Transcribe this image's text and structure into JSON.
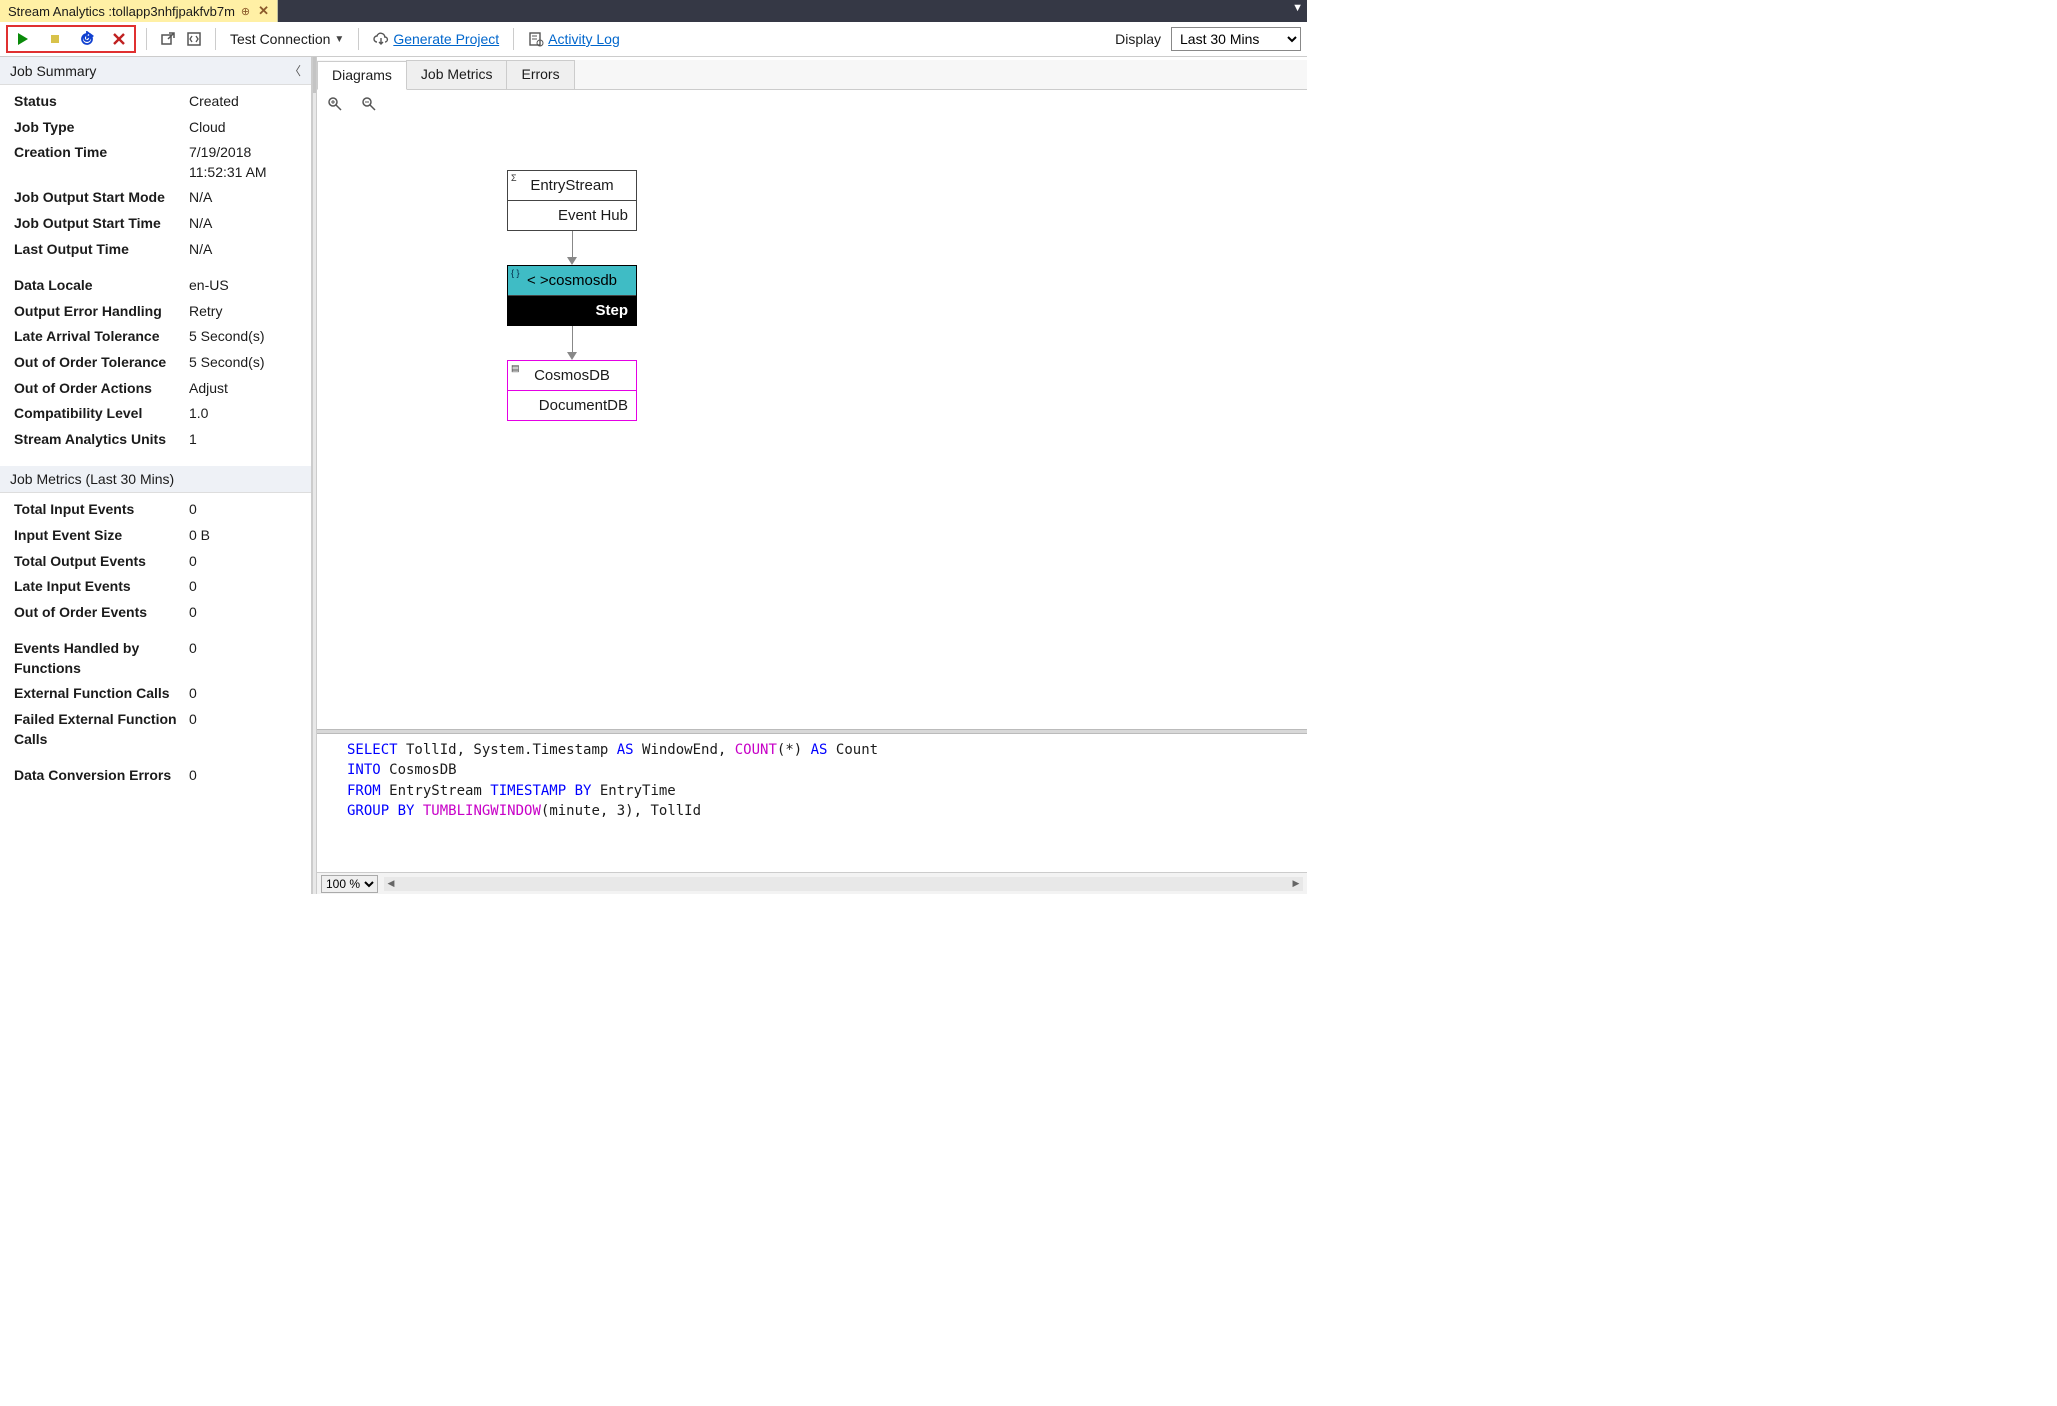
{
  "tab": {
    "prefix": "Stream Analytics : ",
    "name": "tollapp3nhfjpakfvb7m"
  },
  "toolbar": {
    "test_connection": "Test Connection",
    "generate_project": "Generate Project",
    "activity_log": "Activity Log",
    "display_label": "Display",
    "display_value": "Last 30 Mins"
  },
  "summary_header": "Job Summary",
  "summary": [
    {
      "k": "Status",
      "v": "Created"
    },
    {
      "k": "Job Type",
      "v": "Cloud"
    },
    {
      "k": "Creation Time",
      "v": "7/19/2018 11:52:31 AM"
    },
    {
      "k": "Job Output Start Mode",
      "v": "N/A"
    },
    {
      "k": "Job Output Start Time",
      "v": "N/A"
    },
    {
      "k": "Last Output Time",
      "v": "N/A"
    },
    {
      "k": "Data Locale",
      "v": "en-US",
      "gap": true
    },
    {
      "k": "Output Error Handling",
      "v": "Retry"
    },
    {
      "k": "Late Arrival Tolerance",
      "v": "5 Second(s)"
    },
    {
      "k": "Out of Order Tolerance",
      "v": "5 Second(s)"
    },
    {
      "k": "Out of Order Actions",
      "v": "Adjust"
    },
    {
      "k": "Compatibility Level",
      "v": "1.0"
    },
    {
      "k": "Stream Analytics Units",
      "v": "1"
    }
  ],
  "metrics_header": "Job Metrics (Last 30 Mins)",
  "metrics": [
    {
      "k": "Total Input Events",
      "v": "0"
    },
    {
      "k": "Input Event Size",
      "v": "0 B"
    },
    {
      "k": "Total Output Events",
      "v": "0"
    },
    {
      "k": "Late Input Events",
      "v": "0"
    },
    {
      "k": "Out of Order Events",
      "v": "0"
    },
    {
      "k": "Events Handled by Functions",
      "v": "0",
      "gap": true
    },
    {
      "k": "External Function Calls",
      "v": "0"
    },
    {
      "k": "Failed External Function Calls",
      "v": "0"
    },
    {
      "k": "Data Conversion Errors",
      "v": "0",
      "gap": true
    }
  ],
  "right_tabs": [
    "Diagrams",
    "Job Metrics",
    "Errors"
  ],
  "diagram": {
    "entry": {
      "name": "EntryStream",
      "type": "Event Hub"
    },
    "step": {
      "name": "< >cosmosdb",
      "label": "Step"
    },
    "output": {
      "name": "CosmosDB",
      "type": "DocumentDB"
    }
  },
  "zoom_value": "100 %",
  "sql": {
    "l1": {
      "a": "SELECT",
      "b": " TollId, System.Timestamp ",
      "c": "AS",
      "d": " WindowEnd, ",
      "e": "COUNT",
      "f": "(*) ",
      "g": "AS",
      "h": " Count"
    },
    "l2": {
      "a": "INTO",
      "b": " CosmosDB"
    },
    "l3": {
      "a": "FROM",
      "b": " EntryStream ",
      "c": "TIMESTAMP BY",
      "d": " EntryTime"
    },
    "l4": {
      "a": "GROUP BY",
      "b": " ",
      "c": "TUMBLINGWINDOW",
      "d": "(minute, 3), TollId"
    }
  }
}
